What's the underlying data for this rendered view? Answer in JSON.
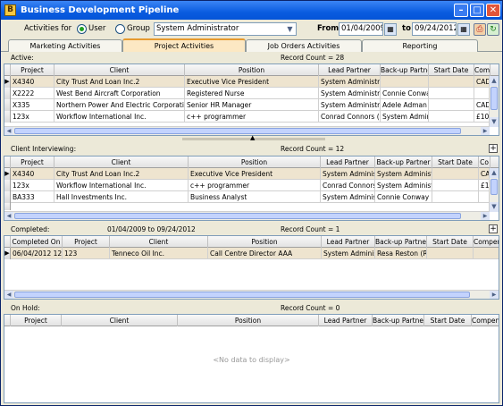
{
  "window": {
    "title": "Business Development Pipeline"
  },
  "filter": {
    "activities_label": "Activities for",
    "user_label": "User",
    "group_label": "Group",
    "selected_scope": "User",
    "user_value": "System Administrator",
    "from_label": "From",
    "from_date": "01/04/2009",
    "to_label": "to",
    "to_date": "09/24/2012"
  },
  "tabs": [
    {
      "label": "Marketing Activities",
      "active": false
    },
    {
      "label": "Project Activities",
      "active": true
    },
    {
      "label": "Job Orders Activities",
      "active": false
    },
    {
      "label": "Reporting",
      "active": false
    }
  ],
  "active_section": {
    "label": "Active:",
    "count": "Record Count = 28",
    "columns": [
      "Project",
      "Client",
      "Position",
      "Lead Partner",
      "Back-up Partner",
      "Start Date",
      "Com"
    ],
    "rows": [
      [
        "X4340",
        "City Trust And Loan Inc.2",
        "Executive Vice President",
        "System Administr",
        "",
        "",
        "CAD"
      ],
      [
        "X2222",
        "West Bend Aircraft Corporation",
        "Registered Nurse",
        "System Administr",
        "Connie Conway",
        "",
        ""
      ],
      [
        "X335",
        "Northern Power And Electric Corporation",
        "Senior HR Manager",
        "System Administr",
        "Adele Adman",
        "",
        "CAD"
      ],
      [
        "123x",
        "Workflow International Inc.",
        "c++ programmer",
        "Conrad Connors (",
        "System Admir",
        "",
        "£100"
      ]
    ]
  },
  "interviewing_section": {
    "label": "Client Interviewing:",
    "count": "Record Count = 12",
    "columns": [
      "Project",
      "Client",
      "Position",
      "Lead Partner",
      "Back-up Partner",
      "Start Date",
      "Co"
    ],
    "rows": [
      [
        "X4340",
        "City Trust And Loan Inc.2",
        "Executive Vice President",
        "System Adminis",
        "System Administr",
        "",
        "CA"
      ],
      [
        "123x",
        "Workflow International Inc.",
        "c++ programmer",
        "Conrad Connors",
        "System Administr",
        "",
        "£10"
      ],
      [
        "BA333",
        "Hall Investments Inc.",
        "Business Analyst",
        "System Adminis",
        "Connie Conway (",
        "",
        ""
      ]
    ]
  },
  "completed_section": {
    "label": "Completed:",
    "range": "01/04/2009 to 09/24/2012",
    "count": "Record Count = 1",
    "columns": [
      "Completed On",
      "Project",
      "Client",
      "Position",
      "Lead Partner",
      "Back-up Partne",
      "Start Date",
      "Compens"
    ],
    "rows": [
      [
        "06/04/2012 12",
        "123",
        "Tenneco Oil Inc.",
        "Call Centre Director AAA",
        "System Adminis",
        "Resa Reston (R",
        "",
        ""
      ]
    ]
  },
  "onhold_section": {
    "label": "On Hold:",
    "count": "Record Count = 0",
    "columns": [
      "Project",
      "Client",
      "Position",
      "Lead Partner",
      "Back-up Partne",
      "Start Date",
      "Compens"
    ],
    "empty_text": "<No data to display>"
  }
}
